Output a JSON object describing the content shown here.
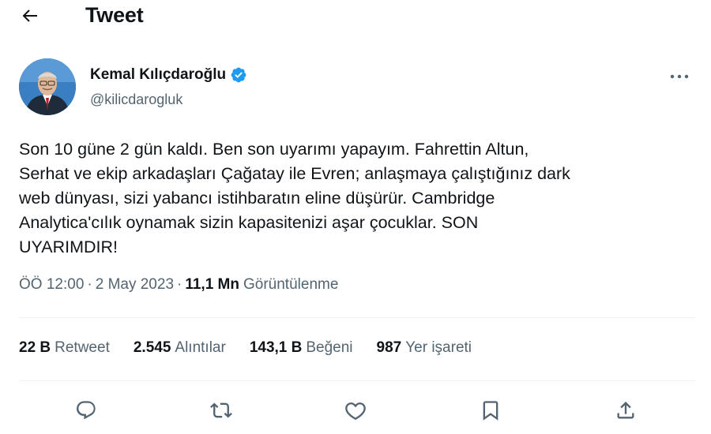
{
  "header": {
    "title": "Tweet",
    "back_icon": "arrow-left-icon"
  },
  "author": {
    "display_name": "Kemal Kılıçdaroğlu",
    "handle": "@kilicdarogluk",
    "verified": true,
    "verified_color": "#1d9bf0",
    "more_icon": "more-horizontal-icon"
  },
  "tweet": {
    "text": "Son 10 güne 2 gün kaldı. Ben son uyarımı yapayım. Fahrettin Altun,\nSerhat ve ekip arkadaşları Çağatay ile Evren; anlaşmaya çalıştığınız dark\nweb dünyası, sizi yabancı istihbaratın eline düşürür. Cambridge\nAnalytica'cılık oynamak sizin kapasitenizi aşar çocuklar. SON\nUYARIMDIR!"
  },
  "meta": {
    "time": "ÖÖ 12:00",
    "separator": "·",
    "date": "2 May 2023",
    "views_count": "11,1 Mn",
    "views_label": "Görüntülenme"
  },
  "stats": [
    {
      "num": "22 B",
      "label": "Retweet"
    },
    {
      "num": "2.545",
      "label": "Alıntılar"
    },
    {
      "num": "143,1 B",
      "label": "Beğeni"
    },
    {
      "num": "987",
      "label": "Yer işareti"
    }
  ],
  "actions": [
    "reply-icon",
    "retweet-icon",
    "like-icon",
    "bookmark-icon",
    "share-icon"
  ],
  "colors": {
    "text_primary": "#0f1419",
    "text_secondary": "#536471",
    "divider": "#eff3f4",
    "accent": "#1d9bf0"
  }
}
